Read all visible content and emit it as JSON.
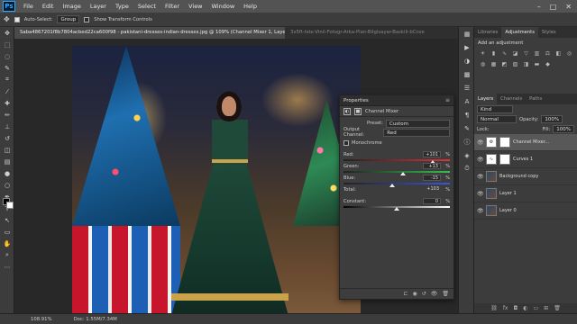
{
  "menubar": {
    "logo": "Ps",
    "items": [
      "File",
      "Edit",
      "Image",
      "Layer",
      "Type",
      "Select",
      "Filter",
      "View",
      "Window",
      "Help"
    ],
    "window_controls": [
      "–",
      "□",
      "✕"
    ]
  },
  "options_bar": {
    "auto_select_label": "Auto-Select:",
    "auto_select_checked": true,
    "target_value": "Group",
    "transform_label": "Show Transform Controls",
    "transform_checked": false
  },
  "doc_tabs": [
    {
      "label": "Saba4867201f8b7804acbed22ca600f98 - pakistani-dresses-indian-dresses.jpg @ 109% (Channel Mixer 1, Layer Mask/8) *",
      "active": true
    },
    {
      "label": "3x5ft-tste-Vinil-Fotogr-Arka-Plan-Bilgisayar-Baskili-bCcee",
      "active": false
    }
  ],
  "properties": {
    "title": "Properties",
    "subtitle": "Channel Mixer",
    "preset_label": "Preset:",
    "preset_value": "Custom",
    "output_label": "Output Channel:",
    "output_value": "Red",
    "monochrome_label": "Monochrome",
    "monochrome_checked": false,
    "sliders": [
      {
        "label": "Red:",
        "value": "+101",
        "fraction": 0.84,
        "track": "linear-gradient(90deg,#222,#e0303a)"
      },
      {
        "label": "Green:",
        "value": "+13",
        "fraction": 0.56,
        "track": "linear-gradient(90deg,#222,#33c04a)"
      },
      {
        "label": "Blue:",
        "value": "-15",
        "fraction": 0.46,
        "track": "linear-gradient(90deg,#222,#3a55e0)"
      }
    ],
    "total_label": "Total:",
    "total_value": "+103",
    "constant_label": "Constant:",
    "constant_value": "0",
    "constant_fraction": 0.5
  },
  "right_panel": {
    "top_tabs": [
      "Libraries",
      "Adjustments",
      "Styles"
    ],
    "active_top_tab": "Adjustments",
    "adjust_title": "Add an adjustment",
    "layer_tabs": [
      "Layers",
      "Channels",
      "Paths"
    ],
    "kind_value": "Kind",
    "blend_value": "Normal",
    "opacity_label": "Opacity:",
    "opacity_value": "100%",
    "lock_label": "Lock:",
    "fill_label": "Fill:",
    "fill_value": "100%",
    "layers": [
      {
        "name": "Channel Mixer...",
        "selected": true,
        "thumb": "⚙"
      },
      {
        "name": "Curves 1",
        "selected": false,
        "thumb": "∿"
      },
      {
        "name": "Background copy",
        "selected": false,
        "thumb": ""
      },
      {
        "name": "Layer 1",
        "selected": false,
        "thumb": ""
      },
      {
        "name": "Layer 0",
        "selected": false,
        "thumb": ""
      }
    ]
  },
  "status": {
    "zoom": "108.91%",
    "doc": "Doc: 1.55M/7.34M"
  }
}
